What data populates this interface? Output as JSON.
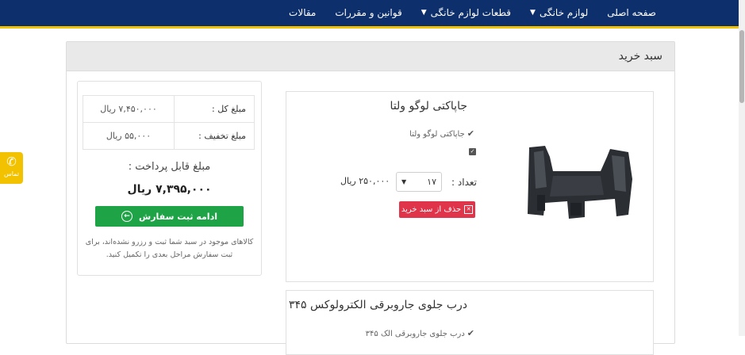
{
  "nav": {
    "items": [
      {
        "label": "صفحه اصلی",
        "has_dropdown": false
      },
      {
        "label": "لوازم خانگی",
        "has_dropdown": true
      },
      {
        "label": "قطعات لوازم خانگی",
        "has_dropdown": true
      },
      {
        "label": "قوانین و مقررات",
        "has_dropdown": false
      },
      {
        "label": "مقالات",
        "has_dropdown": false
      }
    ]
  },
  "cart": {
    "title": "سبد خرید"
  },
  "summary": {
    "total_label": "مبلغ کل :",
    "total_value": "۷,۴۵۰,۰۰۰ ریال",
    "discount_label": "مبلغ تخفیف :",
    "discount_value": "۵۵,۰۰۰ ریال",
    "payable_label": "مبلغ قابل پرداخت :",
    "payable_value": "۷,۳۹۵,۰۰۰ ریال",
    "checkout_label": "ادامه ثبت سفارش",
    "note": "کالاهای موجود در سبد شما ثبت و رزرو نشده‌اند، برای ثبت سفارش مراحل بعدی را تکمیل کنید."
  },
  "items": [
    {
      "title": "جاپاکتی لوگو ولتا",
      "subtitle": "جاپاکتی لوگو ولتا",
      "quantity_label": "تعداد :",
      "quantity": "۱۷",
      "unit_price": "۲۵۰,۰۰۰ ریال",
      "remove_label": "حذف از سبد خرید"
    },
    {
      "title": "درب جلوی جاروبرقی الکترولوکس ۳۴۵",
      "subtitle": "درب جلوی جاروبرقی الک ۳۴۵"
    }
  ],
  "contact": {
    "label": "تماس"
  },
  "colors": {
    "navbar": "#0d2f6b",
    "navbar_border": "#f2c200",
    "checkout_button": "#1fa347",
    "remove_button": "#e0344a",
    "contact_tab": "#f2c200"
  }
}
